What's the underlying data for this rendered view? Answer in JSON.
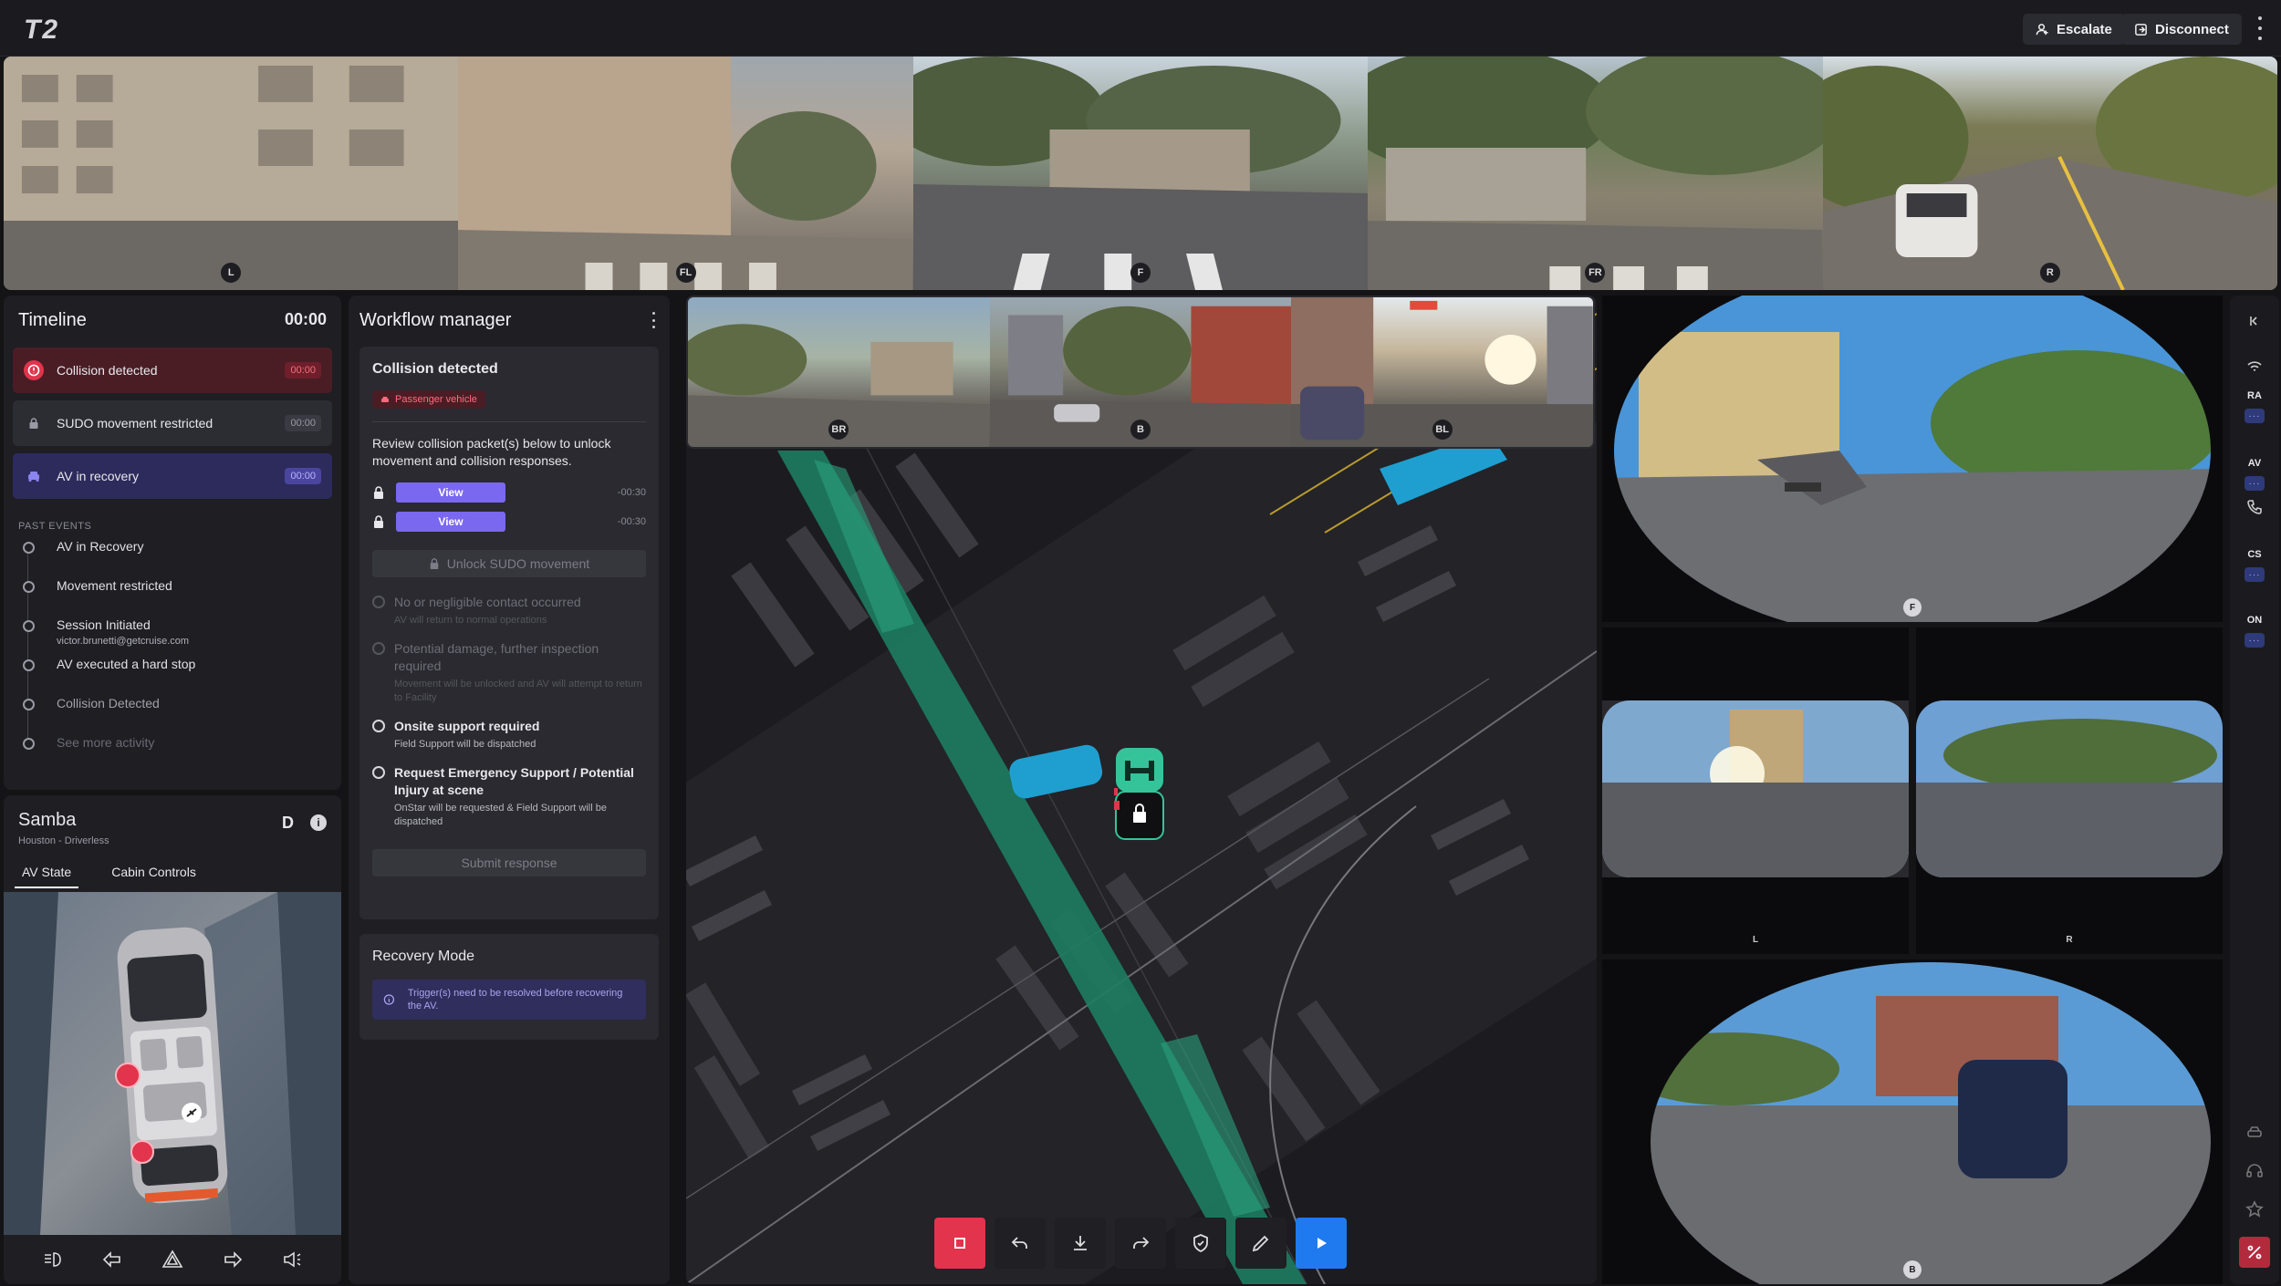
{
  "app": {
    "logo": "T2"
  },
  "topbar": {
    "escalate": "Escalate",
    "disconnect": "Disconnect"
  },
  "front_cameras": [
    {
      "label": "L"
    },
    {
      "label": "FL"
    },
    {
      "label": "F"
    },
    {
      "label": "FR"
    },
    {
      "label": "R"
    }
  ],
  "rear_cameras": [
    {
      "label": "BR"
    },
    {
      "label": "B"
    },
    {
      "label": "BL"
    }
  ],
  "fisheye": {
    "front": "F",
    "left": "L",
    "right": "R",
    "back": "B"
  },
  "timeline": {
    "title": "Timeline",
    "time": "00:00",
    "active_events": [
      {
        "label": "Collision detected",
        "time": "00:00"
      },
      {
        "label": "SUDO movement restricted",
        "time": "00:00"
      },
      {
        "label": "AV in recovery",
        "time": "00:00"
      }
    ],
    "past_label": "PAST EVENTS",
    "past_events": [
      {
        "label": "AV in Recovery",
        "sub": ""
      },
      {
        "label": "Movement restricted",
        "sub": ""
      },
      {
        "label": "Session Initiated",
        "sub": "victor.brunetti@getcruise.com"
      },
      {
        "label": "AV executed a hard stop",
        "sub": ""
      },
      {
        "label": "Collision Detected",
        "sub": ""
      }
    ],
    "see_more": "See more activity"
  },
  "vehicle": {
    "name": "Samba",
    "subtitle": "Houston - Driverless",
    "gear": "D",
    "info": "i",
    "tabs": [
      "AV State",
      "Cabin Controls"
    ]
  },
  "workflow": {
    "title": "Workflow manager",
    "card_title": "Collision detected",
    "pill": "Passenger vehicle",
    "description": "Review collision packet(s) below to unlock movement and collision responses.",
    "packets": [
      {
        "button": "View",
        "time": "-00:30"
      },
      {
        "button": "View",
        "time": "-00:30"
      }
    ],
    "unlock_button": "Unlock SUDO movement",
    "options": [
      {
        "title": "No or negligible contact occurred",
        "sub": "AV will return to normal operations",
        "enabled": false
      },
      {
        "title": "Potential damage, further inspection required",
        "sub": "Movement will be unlocked and AV will attempt to return to Facility",
        "enabled": false
      },
      {
        "title": "Onsite support required",
        "sub": "Field Support will be dispatched",
        "enabled": true
      },
      {
        "title": "Request Emergency Support / Potential Injury at scene",
        "sub": "OnStar will be requested & Field Support will be dispatched",
        "enabled": true
      }
    ],
    "submit": "Submit response",
    "recovery_title": "Recovery Mode",
    "recovery_note": "Trigger(s) need to be resolved before recovering the AV."
  },
  "rail": {
    "items": [
      "RA",
      "AV",
      "CS",
      "ON"
    ],
    "dots": "···"
  },
  "colors": {
    "accent": "#7a68f0",
    "danger": "#e2344c",
    "go": "#1f7af0",
    "path": "#2fae86",
    "ego": "#35c39a",
    "other_vehicle": "#1f9fd0"
  }
}
